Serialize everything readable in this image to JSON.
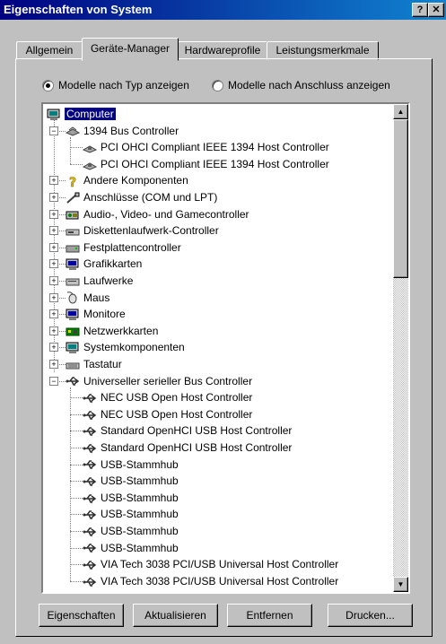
{
  "window": {
    "title": "Eigenschaften von System",
    "help_glyph": "?",
    "close_glyph": "✕"
  },
  "tabs": [
    {
      "label": "Allgemein"
    },
    {
      "label": "Geräte-Manager"
    },
    {
      "label": "Hardwareprofile"
    },
    {
      "label": "Leistungsmerkmale"
    }
  ],
  "view_options": {
    "by_type": "Modelle nach Typ anzeigen",
    "by_connection": "Modelle nach Anschluss anzeigen",
    "selected": "by_type"
  },
  "tree": {
    "root": "Computer",
    "items": [
      {
        "label": "1394 Bus Controller",
        "expanded": true,
        "icon": "firewire-icon"
      },
      {
        "label": "PCI OHCI Compliant IEEE 1394 Host Controller",
        "child": true,
        "icon": "chip-icon"
      },
      {
        "label": "PCI OHCI Compliant IEEE 1394 Host Controller",
        "child": true,
        "icon": "chip-icon"
      },
      {
        "label": "Andere Komponenten",
        "icon": "question-icon"
      },
      {
        "label": "Anschlüsse (COM und LPT)",
        "icon": "port-icon"
      },
      {
        "label": "Audio-, Video- und Gamecontroller",
        "icon": "audio-icon"
      },
      {
        "label": "Diskettenlaufwerk-Controller",
        "icon": "floppy-icon"
      },
      {
        "label": "Festplattencontroller",
        "icon": "harddisk-icon"
      },
      {
        "label": "Grafikkarten",
        "icon": "monitor-icon"
      },
      {
        "label": "Laufwerke",
        "icon": "drive-icon"
      },
      {
        "label": "Maus",
        "icon": "mouse-icon"
      },
      {
        "label": "Monitore",
        "icon": "monitor-icon"
      },
      {
        "label": "Netzwerkkarten",
        "icon": "network-icon"
      },
      {
        "label": "Systemkomponenten",
        "icon": "computer-icon"
      },
      {
        "label": "Tastatur",
        "icon": "keyboard-icon"
      },
      {
        "label": "Universeller serieller Bus Controller",
        "expanded": true,
        "icon": "usb-icon"
      },
      {
        "label": "NEC USB Open Host Controller",
        "child": true,
        "icon": "usb-icon"
      },
      {
        "label": "NEC USB Open Host Controller",
        "child": true,
        "icon": "usb-icon"
      },
      {
        "label": "Standard OpenHCI USB Host Controller",
        "child": true,
        "icon": "usb-icon"
      },
      {
        "label": "Standard OpenHCI USB Host Controller",
        "child": true,
        "icon": "usb-icon"
      },
      {
        "label": "USB-Stammhub",
        "child": true,
        "icon": "usb-icon"
      },
      {
        "label": "USB-Stammhub",
        "child": true,
        "icon": "usb-icon"
      },
      {
        "label": "USB-Stammhub",
        "child": true,
        "icon": "usb-icon"
      },
      {
        "label": "USB-Stammhub",
        "child": true,
        "icon": "usb-icon"
      },
      {
        "label": "USB-Stammhub",
        "child": true,
        "icon": "usb-icon"
      },
      {
        "label": "USB-Stammhub",
        "child": true,
        "icon": "usb-icon"
      },
      {
        "label": "VIA Tech 3038 PCI/USB Universal Host Controller",
        "child": true,
        "icon": "usb-icon"
      },
      {
        "label": "VIA Tech 3038 PCI/USB Universal Host Controller",
        "child": true,
        "icon": "usb-icon"
      }
    ]
  },
  "buttons": {
    "properties": "Eigenschaften",
    "refresh": "Aktualisieren",
    "remove": "Entfernen",
    "print": "Drucken..."
  },
  "colors": {
    "titlebar": "#000080",
    "selection": "#000080",
    "face": "#c0c0c0"
  }
}
